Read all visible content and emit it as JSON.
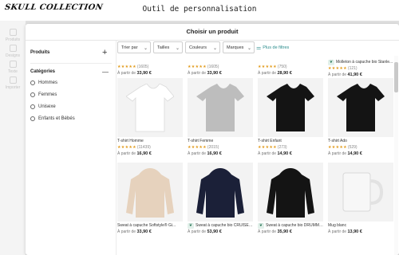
{
  "app": {
    "logo": "SKULL COLLECTION",
    "title": "Outil de personnalisation"
  },
  "rail": {
    "items": [
      {
        "label": "Produits",
        "icon": "box-icon"
      },
      {
        "label": "Designs",
        "icon": "brush-icon"
      },
      {
        "label": "Texte",
        "icon": "text-icon"
      },
      {
        "label": "Importer",
        "icon": "upload-icon"
      }
    ]
  },
  "modal": {
    "title": "Choisir un produit",
    "sidebar": {
      "products_heading": "Produits",
      "products_toggle": "+",
      "categories_heading": "Catégories",
      "categories_toggle": "—",
      "categories": [
        {
          "label": "Hommes",
          "icon": "male-icon"
        },
        {
          "label": "Femmes",
          "icon": "female-icon"
        },
        {
          "label": "Unisexe",
          "icon": "unisex-icon"
        },
        {
          "label": "Enfants et Bébés",
          "icon": "baby-icon"
        }
      ]
    },
    "filters": [
      {
        "label": "Trier par"
      },
      {
        "label": "Tailles"
      },
      {
        "label": "Couleurs"
      },
      {
        "label": "Marques"
      }
    ],
    "more_filters": "Plus de filtres",
    "partial_row": [
      {
        "rating_count": "(1605)",
        "price_prefix": "À partir de",
        "price": "33,90 €",
        "eco": false
      },
      {
        "rating_count": "(1605)",
        "price_prefix": "À partir de",
        "price": "33,90 €",
        "eco": false
      },
      {
        "rating_count": "(750)",
        "price_prefix": "À partir de",
        "price": "28,90 €",
        "eco": false
      },
      {
        "name": "Molleton à capuche bio Stanle...",
        "rating_count": "(121)",
        "price_prefix": "À partir de",
        "price": "41,90 €",
        "eco": true
      }
    ],
    "products": [
      {
        "name": "T-shirt Homme",
        "rating_count": "(11439)",
        "price_prefix": "À partir de",
        "price": "16,90 €",
        "color": "#ffffff",
        "kind": "tee",
        "eco": false
      },
      {
        "name": "T-shirt Femme",
        "rating_count": "(2015)",
        "price_prefix": "À partir de",
        "price": "16,90 €",
        "color": "#bdbdbd",
        "kind": "tee",
        "eco": false
      },
      {
        "name": "T-shirt Enfant",
        "rating_count": "(273)",
        "price_prefix": "À partir de",
        "price": "14,90 €",
        "color": "#141414",
        "kind": "tee",
        "eco": false
      },
      {
        "name": "T-shirt Ado",
        "rating_count": "(529)",
        "price_prefix": "À partir de",
        "price": "14,90 €",
        "color": "#141414",
        "kind": "tee",
        "eco": false
      },
      {
        "name": "Sweat à capuche Softstyle® Gi...",
        "rating_count": "",
        "price_prefix": "À partir de",
        "price": "33,90 €",
        "color": "#e6d2bd",
        "kind": "hoodie",
        "eco": false
      },
      {
        "name": "Sweat à capuche bio CRUISER ...",
        "rating_count": "",
        "price_prefix": "À partir de",
        "price": "53,90 €",
        "color": "#1b2038",
        "kind": "hoodie",
        "eco": true
      },
      {
        "name": "Sweat à capuche bio DRUMME...",
        "rating_count": "",
        "price_prefix": "À partir de",
        "price": "35,90 €",
        "color": "#141414",
        "kind": "hoodie",
        "eco": true
      },
      {
        "name": "Mug blanc",
        "rating_count": "",
        "price_prefix": "À partir de",
        "price": "13,90 €",
        "color": "#f7f7f7",
        "kind": "mug",
        "eco": false
      }
    ]
  }
}
